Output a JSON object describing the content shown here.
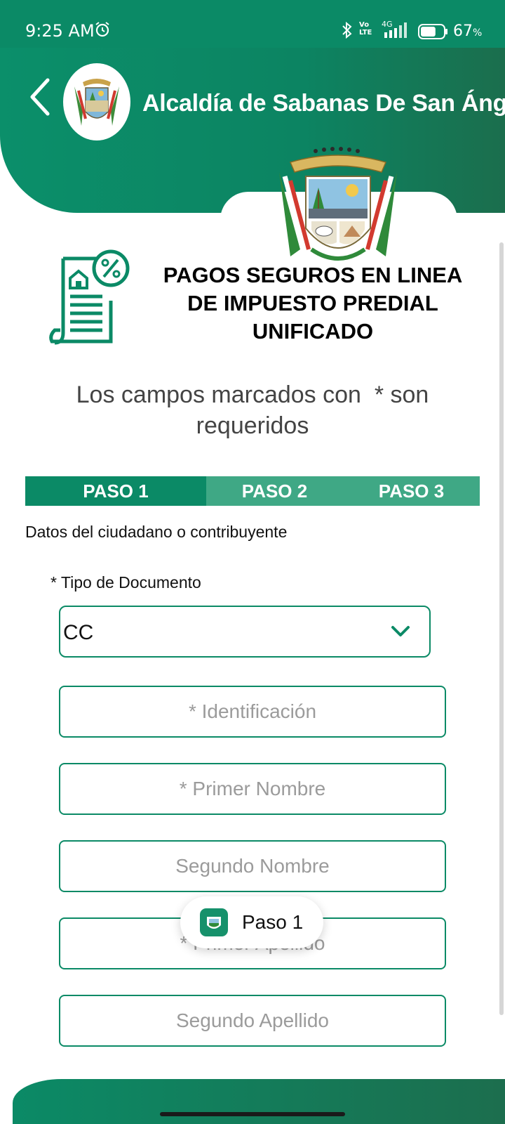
{
  "status_bar": {
    "time": "9:25 AM",
    "volte": [
      "Vo",
      "LTE"
    ],
    "network": "4G",
    "battery_level": 67,
    "battery_label": "67",
    "battery_unit": "%"
  },
  "header": {
    "title": "Alcaldía de Sabanas De San Ángel",
    "back_icon": "chevron-left-icon"
  },
  "page": {
    "title_lines": [
      "PAGOS SEGUROS EN LINEA",
      "DE IMPUESTO PREDIAL",
      "UNIFICADO"
    ],
    "required_note_lines": [
      "Los campos marcados con  * son",
      "requeridos"
    ],
    "section_label": "Datos del ciudadano o contribuyente"
  },
  "steps": [
    {
      "label": "PASO 1",
      "active": true
    },
    {
      "label": "PASO 2",
      "active": false
    },
    {
      "label": "PASO 3",
      "active": false
    }
  ],
  "form": {
    "doc_type_label": "* Tipo de Documento",
    "doc_type_value": "CC",
    "fields": [
      {
        "placeholder": "* Identificación",
        "value": ""
      },
      {
        "placeholder": "* Primer Nombre",
        "value": ""
      },
      {
        "placeholder": "Segundo Nombre",
        "value": ""
      },
      {
        "placeholder": "* Primer Apellido",
        "value": ""
      },
      {
        "placeholder": "Segundo Apellido",
        "value": ""
      }
    ]
  },
  "toast": {
    "text": "Paso 1"
  },
  "colors": {
    "primary": "#0b8a66",
    "step_inactive": "#3fa885",
    "placeholder": "#9b9b9b"
  }
}
